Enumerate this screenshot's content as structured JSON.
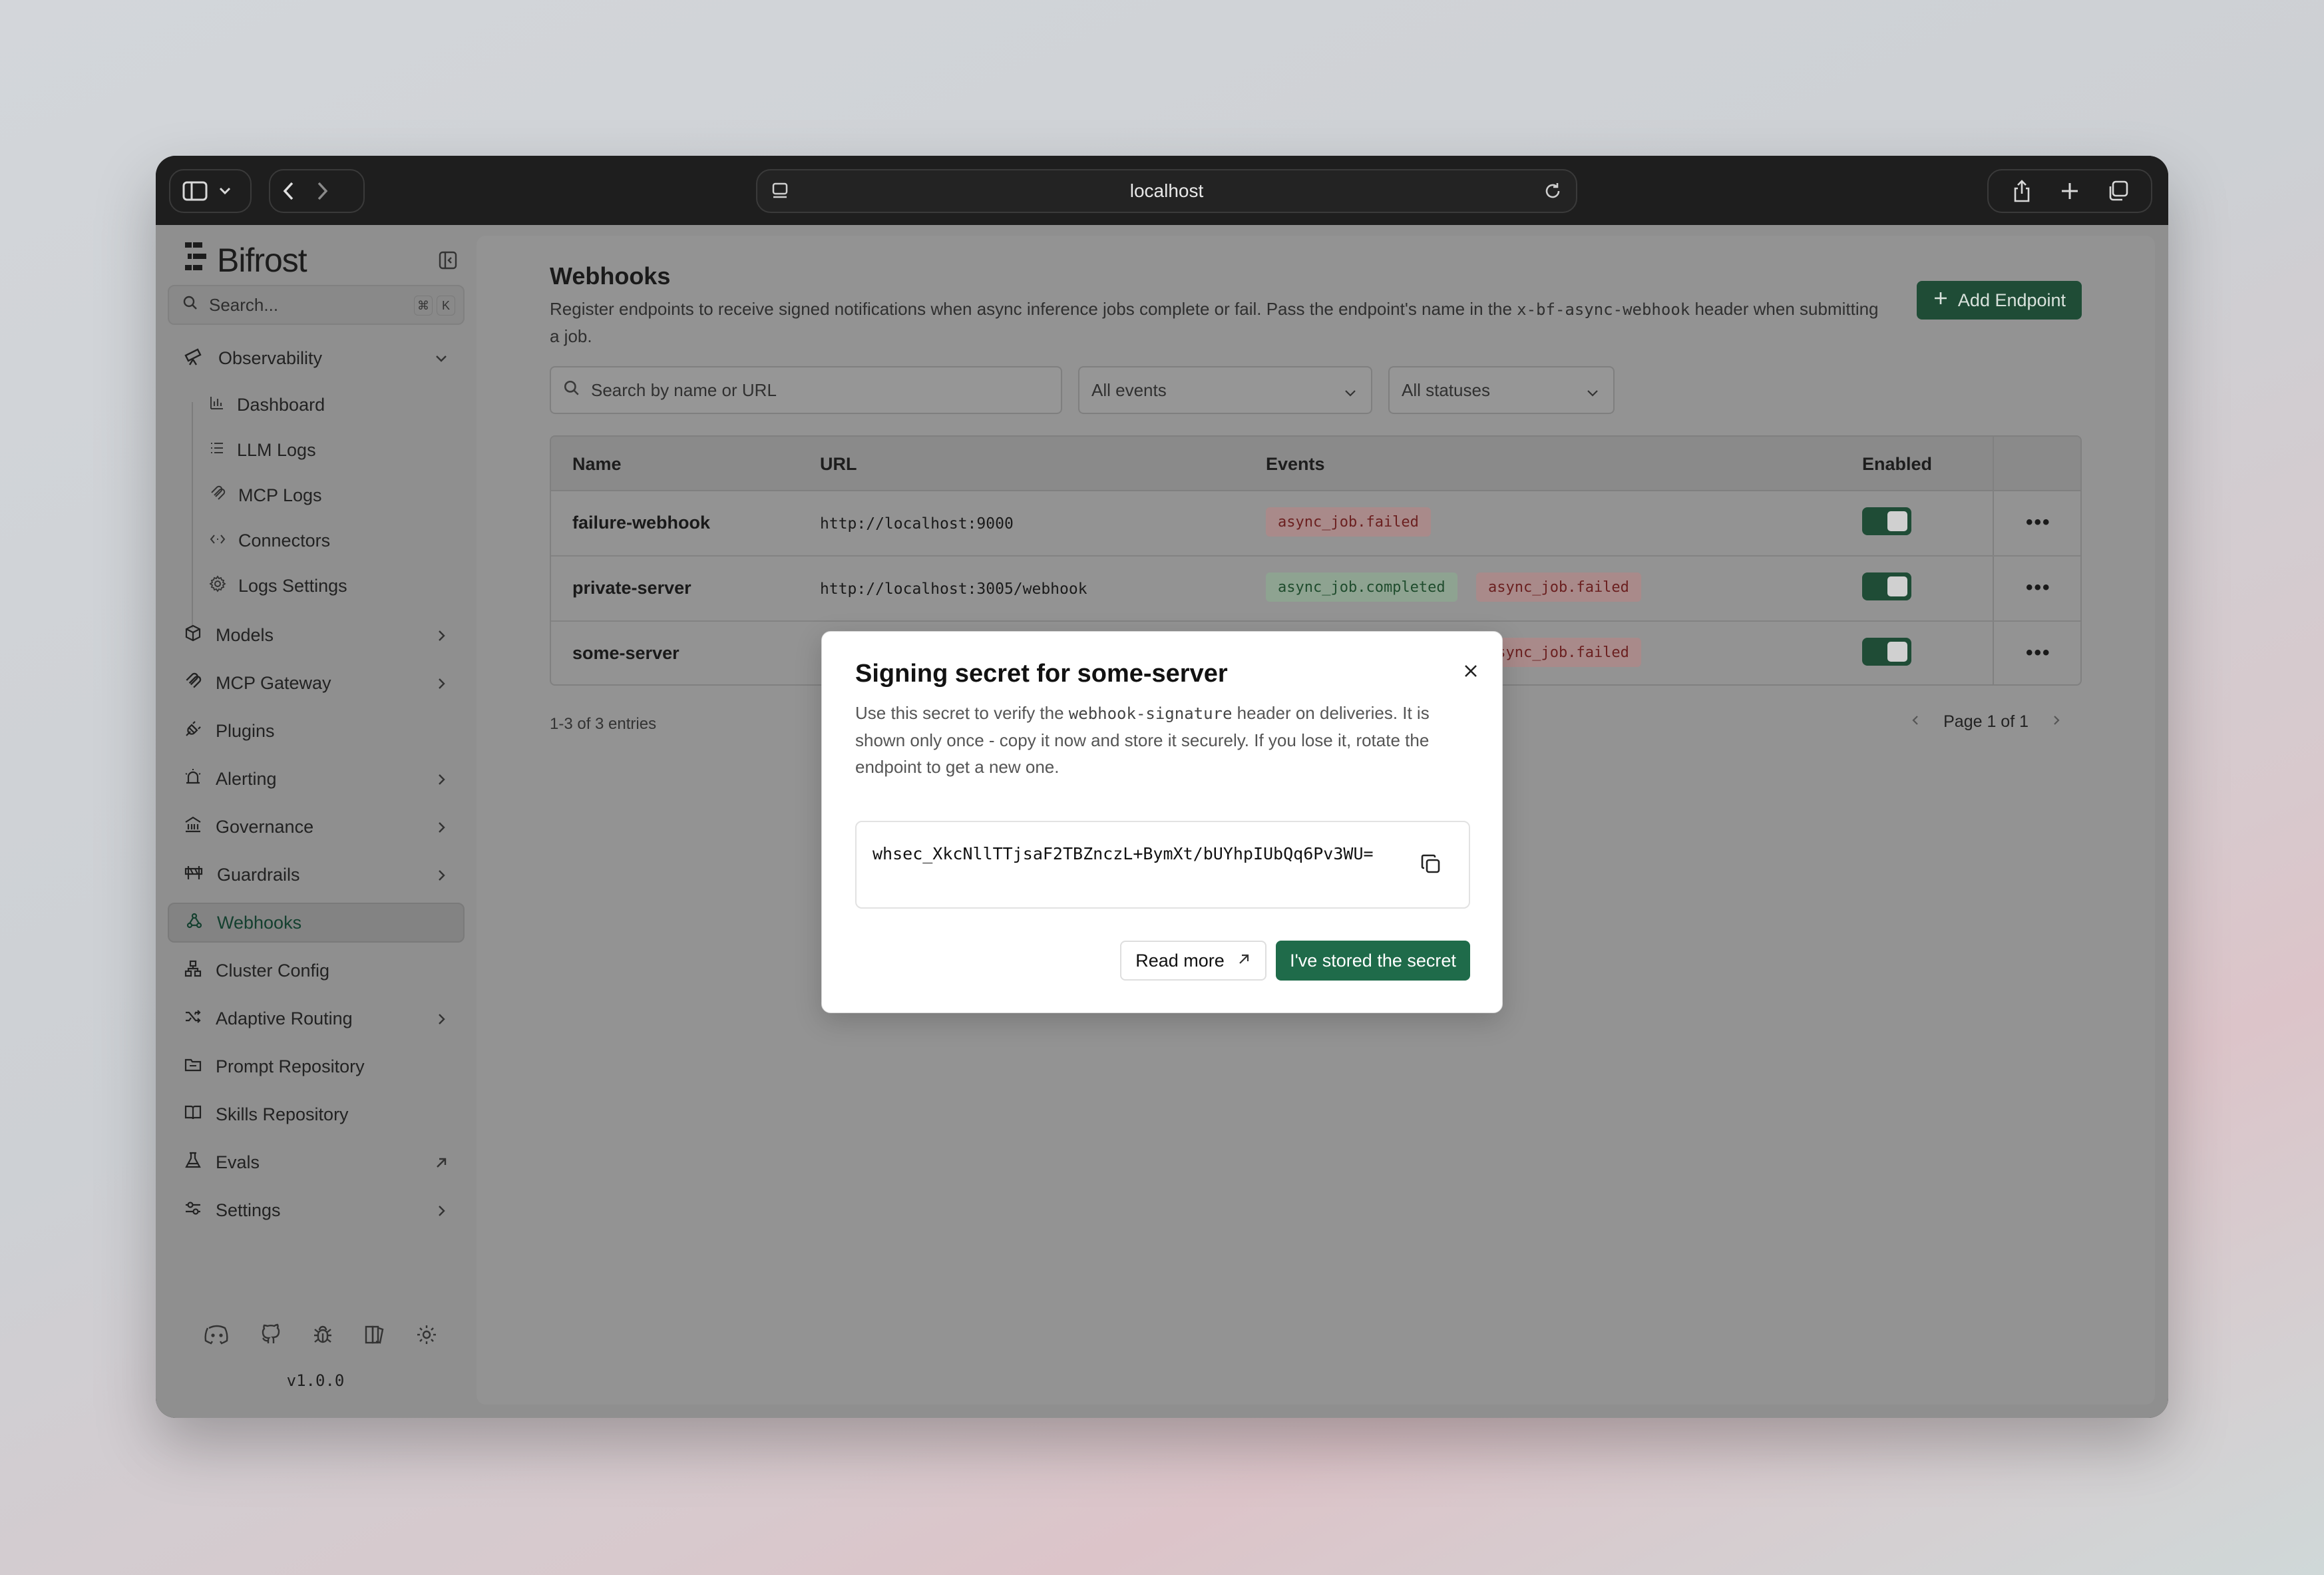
{
  "browser": {
    "url": "localhost"
  },
  "sidebar": {
    "brand": "Bifrost",
    "search_placeholder": "Search...",
    "shortcut_keys": [
      "⌘",
      "K"
    ],
    "observability": {
      "label": "Observability",
      "children": [
        "Dashboard",
        "LLM Logs",
        "MCP Logs",
        "Connectors",
        "Logs Settings"
      ]
    },
    "items": [
      {
        "label": "Models"
      },
      {
        "label": "MCP Gateway"
      },
      {
        "label": "Plugins"
      },
      {
        "label": "Alerting"
      },
      {
        "label": "Governance"
      },
      {
        "label": "Guardrails"
      },
      {
        "label": "Webhooks"
      },
      {
        "label": "Cluster Config"
      },
      {
        "label": "Adaptive Routing"
      },
      {
        "label": "Prompt Repository"
      },
      {
        "label": "Skills Repository"
      },
      {
        "label": "Evals"
      },
      {
        "label": "Settings"
      }
    ],
    "version": "v1.0.0"
  },
  "main": {
    "title": "Webhooks",
    "description_1": "Register endpoints to receive signed notifications when async inference jobs complete or fail. Pass the endpoint's name in the ",
    "description_code": "x-bf-async-webhook",
    "description_2": " header when submitting a job.",
    "add_button": "Add Endpoint",
    "search_placeholder": "Search by name or URL",
    "filter_events": "All events",
    "filter_statuses": "All statuses",
    "table": {
      "headers": [
        "Name",
        "URL",
        "Events",
        "Enabled"
      ],
      "rows": [
        {
          "name": "failure-webhook",
          "url": "http://localhost:9000",
          "events": [
            "async_job.failed"
          ]
        },
        {
          "name": "private-server",
          "url": "http://localhost:3005/webhook",
          "events": [
            "async_job.completed",
            "async_job.failed"
          ]
        },
        {
          "name": "some-server",
          "url": "",
          "events": [
            "async_job.failed"
          ]
        }
      ]
    },
    "entries_text": "1-3 of 3 entries",
    "page_text": "Page 1 of 1"
  },
  "modal": {
    "title": "Signing secret for some-server",
    "body_1": "Use this secret to verify the ",
    "body_code": "webhook-signature",
    "body_2": " header on deliveries. It is shown only once - copy it now and store it securely. If you lose it, rotate the endpoint to get a new one.",
    "secret": "whsec_XkcNllTTjsaF2TBZnczL+BymXt/bUYhpIUbQq6Pv3WU=",
    "read_more": "Read more",
    "stored_button": "I've stored the secret"
  },
  "colors": {
    "accent": "#1f6b4a",
    "accent_dim": "#1f4c36"
  }
}
